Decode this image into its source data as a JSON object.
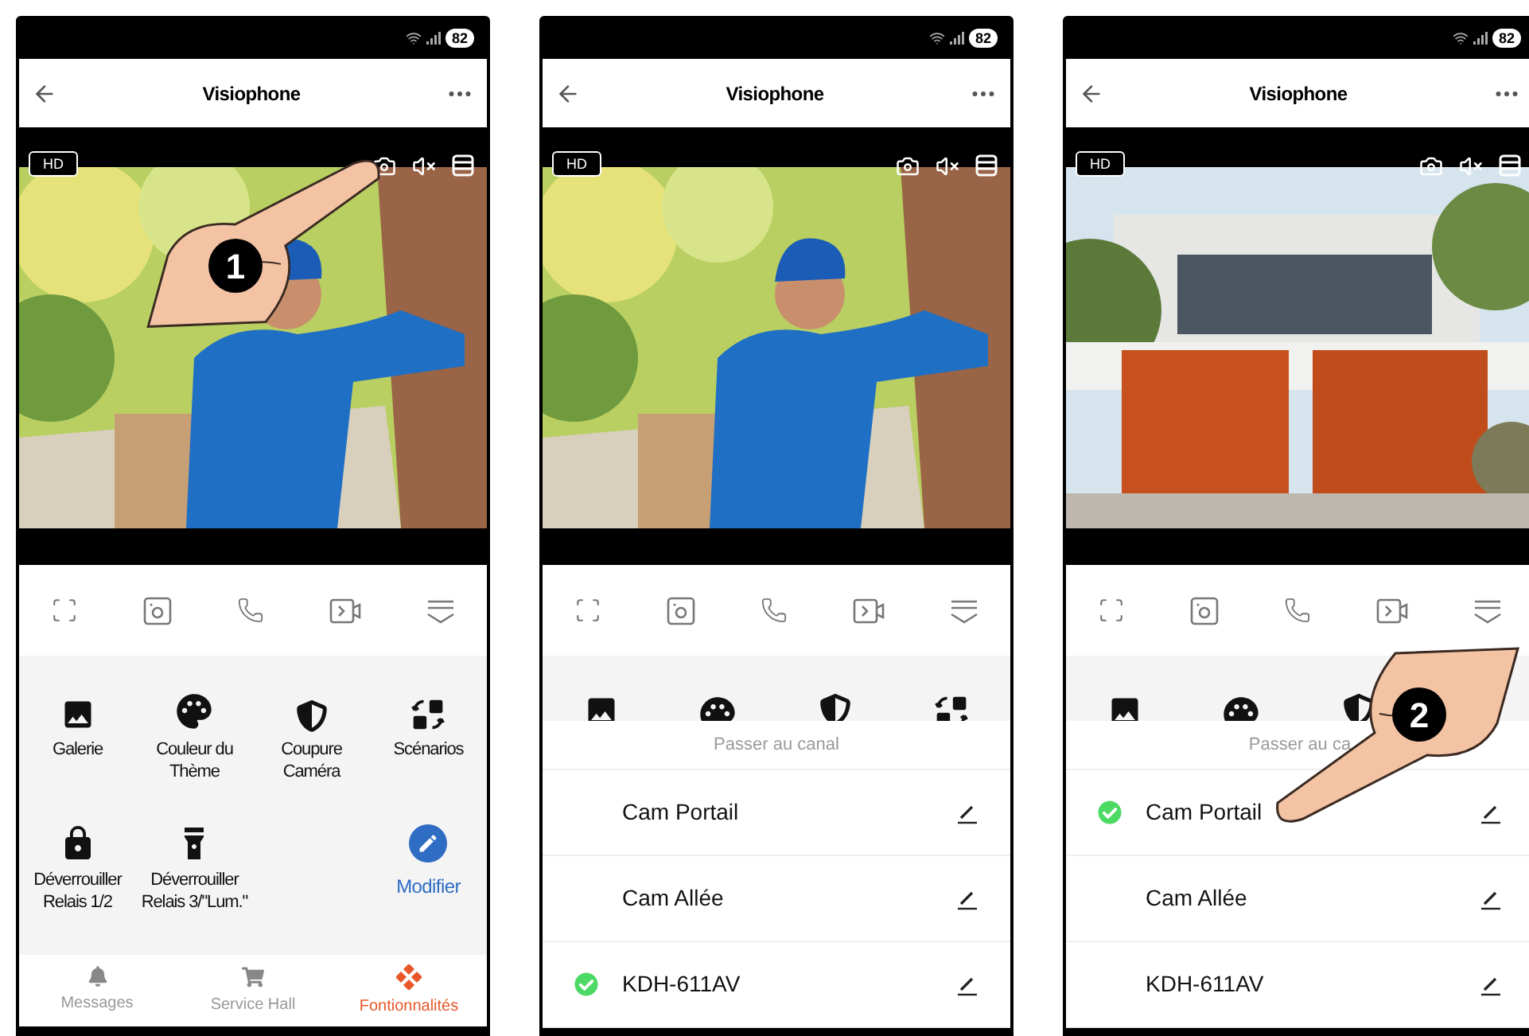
{
  "phones": [
    {
      "status": {
        "battery": "82"
      },
      "header": {
        "title": "Visiophone"
      },
      "video": {
        "quality": "HD"
      },
      "pointer": {
        "step": "1"
      },
      "panel": {
        "kind": "features",
        "items": [
          {
            "label": "Galerie"
          },
          {
            "label": "Couleur du Thème"
          },
          {
            "label": "Coupure Caméra"
          },
          {
            "label": "Scénarios"
          },
          {
            "label": "Déverrouiller Relais 1/2"
          },
          {
            "label": "Déverrouiller Relais 3/\"Lum.\""
          }
        ],
        "edit": "Modifier"
      },
      "nav": [
        {
          "label": "Messages",
          "selected": false
        },
        {
          "label": "Service Hall",
          "selected": false
        },
        {
          "label": "Fontionnalités",
          "selected": true
        }
      ]
    },
    {
      "status": {
        "battery": "82"
      },
      "header": {
        "title": "Visiophone"
      },
      "video": {
        "quality": "HD"
      },
      "panel": {
        "kind": "channels",
        "title": "Passer au canal",
        "channels": [
          {
            "name": "Cam Portail",
            "selected": false
          },
          {
            "name": "Cam Allée",
            "selected": false
          },
          {
            "name": "KDH-611AV",
            "selected": true
          }
        ]
      }
    },
    {
      "status": {
        "battery": "82"
      },
      "header": {
        "title": "Visiophone"
      },
      "video": {
        "quality": "HD"
      },
      "pointer": {
        "step": "2"
      },
      "panel": {
        "kind": "channels",
        "title": "Passer au ca",
        "channels": [
          {
            "name": "Cam Portail",
            "selected": true
          },
          {
            "name": "Cam Allée",
            "selected": false
          },
          {
            "name": "KDH-611AV",
            "selected": false
          }
        ]
      }
    }
  ]
}
